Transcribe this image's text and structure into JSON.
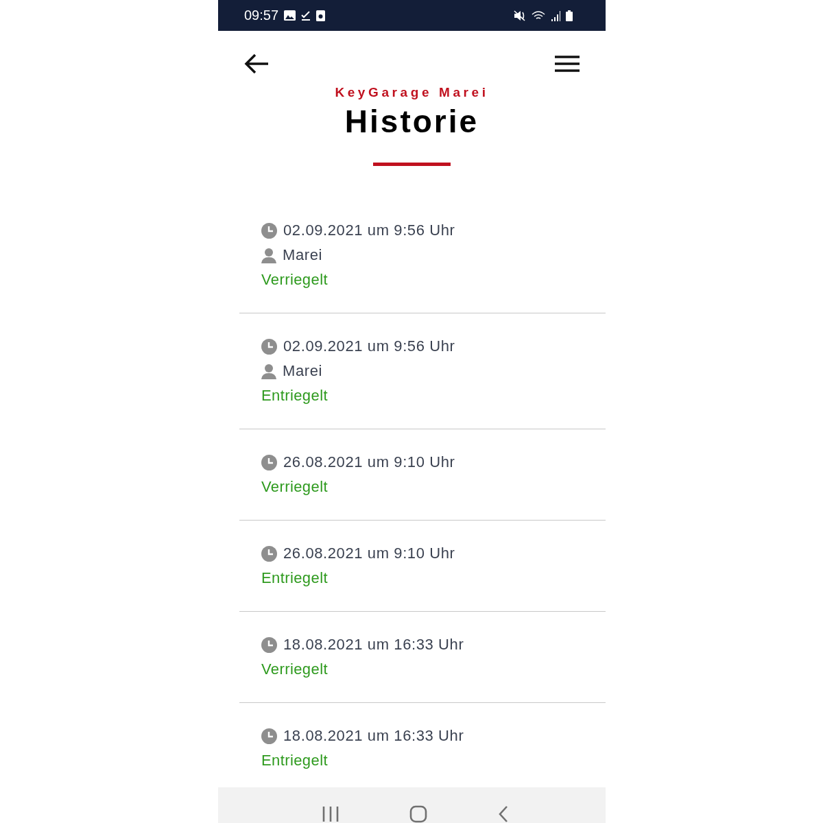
{
  "status_bar": {
    "time": "09:57"
  },
  "header": {
    "subtitle": "KeyGarage Marei",
    "title": "Historie"
  },
  "entries": [
    {
      "time": "02.09.2021 um 9:56 Uhr",
      "user": "Marei",
      "status": "Verriegelt"
    },
    {
      "time": "02.09.2021 um 9:56 Uhr",
      "user": "Marei",
      "status": "Entriegelt"
    },
    {
      "time": "26.08.2021 um 9:10 Uhr",
      "status": "Verriegelt"
    },
    {
      "time": "26.08.2021 um 9:10 Uhr",
      "status": "Entriegelt"
    },
    {
      "time": "18.08.2021 um 16:33 Uhr",
      "status": "Verriegelt"
    },
    {
      "time": "18.08.2021 um 16:33 Uhr",
      "status": "Entriegelt"
    }
  ]
}
